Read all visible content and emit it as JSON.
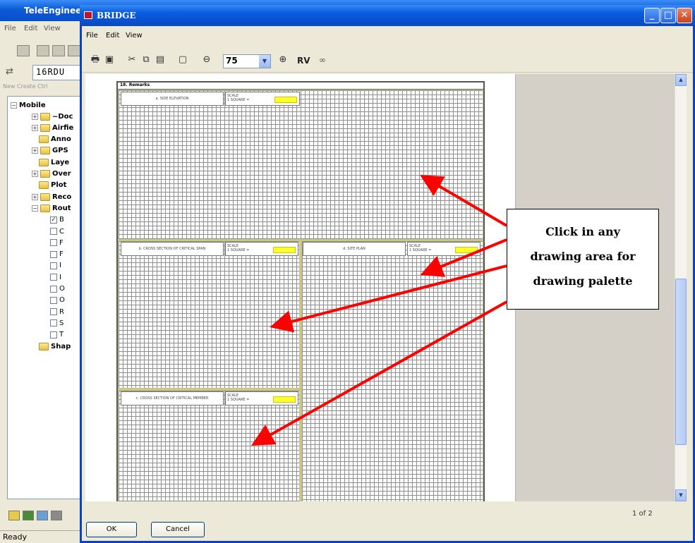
{
  "background_window": {
    "title": "TeleEngineer",
    "menu": [
      "File",
      "Edit",
      "View"
    ],
    "ident_field": "16RDU",
    "subheader": "New Create Ctrl",
    "tree": {
      "root": "Mobile",
      "items": [
        {
          "label": "~Doc",
          "kind": "folder",
          "expander": "+"
        },
        {
          "label": "Airfie",
          "kind": "folder",
          "expander": "+"
        },
        {
          "label": "Anno",
          "kind": "folder",
          "expander": ""
        },
        {
          "label": "GPS",
          "kind": "folder",
          "expander": "+"
        },
        {
          "label": "Laye",
          "kind": "folder",
          "expander": ""
        },
        {
          "label": "Over",
          "kind": "folder",
          "expander": "+"
        },
        {
          "label": "Plot",
          "kind": "folder",
          "expander": ""
        },
        {
          "label": "Reco",
          "kind": "folder",
          "expander": "+"
        },
        {
          "label": "Rout",
          "kind": "folder",
          "expander": "−"
        },
        {
          "label": "B",
          "kind": "check",
          "checked": true
        },
        {
          "label": "C",
          "kind": "check",
          "checked": false
        },
        {
          "label": "F",
          "kind": "check",
          "checked": false
        },
        {
          "label": "F",
          "kind": "check",
          "checked": false
        },
        {
          "label": "I",
          "kind": "check",
          "checked": false
        },
        {
          "label": "I",
          "kind": "check",
          "checked": false
        },
        {
          "label": "O",
          "kind": "check",
          "checked": false
        },
        {
          "label": "O",
          "kind": "check",
          "checked": false
        },
        {
          "label": "R",
          "kind": "check",
          "checked": false
        },
        {
          "label": "S",
          "kind": "check",
          "checked": false
        },
        {
          "label": "T",
          "kind": "check",
          "checked": false
        },
        {
          "label": "Shap",
          "kind": "folder",
          "expander": ""
        }
      ]
    },
    "status": "Ready"
  },
  "dialog": {
    "title": "BRIDGE",
    "caption_buttons": {
      "minimize": "_",
      "maximize": "□",
      "close": "✕"
    },
    "menu": [
      "File",
      "Edit",
      "View"
    ],
    "toolbar": {
      "icons": [
        "print-icon",
        "save-icon",
        "cut-icon",
        "copy-icon",
        "paste-icon",
        "new-page-icon",
        "zoom-out-icon",
        "zoom-in-icon"
      ],
      "zoom_value": "75",
      "rv_label": "RV",
      "link_label": "∞"
    },
    "form": {
      "header": "18. Remarks",
      "sections": {
        "side_elevation": {
          "label": "a.   SIDE ELEVATION",
          "scale": "SCALE\n1 SQUARE ="
        },
        "cross_section_span": {
          "label": "b.   CROSS SECTION OF CRITICAL SPAN",
          "scale": "SCALE\n1 SQUARE ="
        },
        "site_plan": {
          "label": "d.   SITE PLAN",
          "scale": "SCALE\n1 SQUARE ="
        },
        "cross_section_member": {
          "label": "c.   CROSS SECTION OF CRITICAL MEMBER",
          "scale": "SCALE\n1 SQUARE ="
        }
      }
    },
    "page_indicator": "1 of 2",
    "buttons": {
      "ok": "OK",
      "cancel": "Cancel"
    }
  },
  "callout": {
    "lines": [
      "Click in any",
      "drawing area for",
      "drawing palette"
    ],
    "arrow_color": "#ff0000"
  },
  "colors": {
    "title_bar": "#0a52d3",
    "grid_highlight": "#ffff2a",
    "grid_border": "#c9c985"
  }
}
